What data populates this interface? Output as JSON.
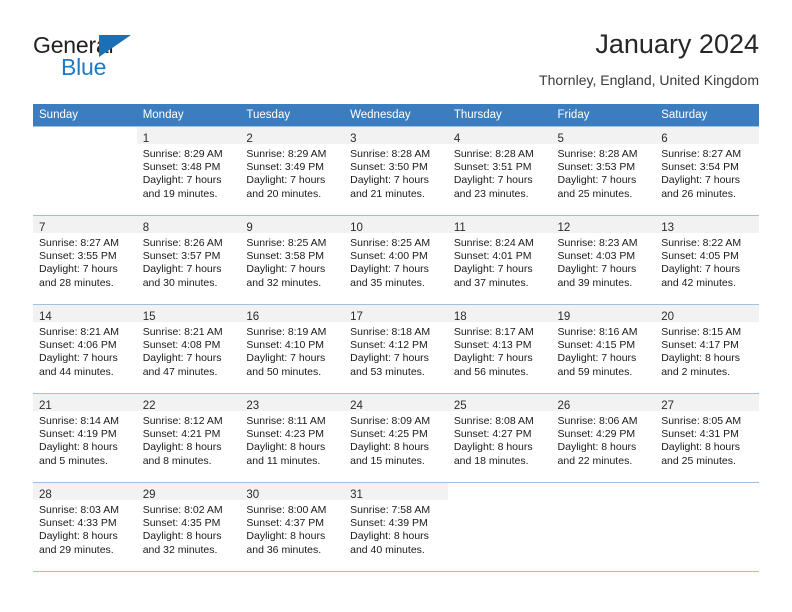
{
  "brand": {
    "name_part1": "General",
    "name_part2": "Blue",
    "logo_icon": "triangle-logo-icon"
  },
  "header": {
    "title": "January 2024",
    "subtitle": "Thornley, England, United Kingdom"
  },
  "colors": {
    "header_bar": "#3b7dbf",
    "brand_blue": "#1f7ac4",
    "daynum_bg": "#f2f2f2",
    "row_border": "#9fc0de"
  },
  "weekday_headers": [
    "Sunday",
    "Monday",
    "Tuesday",
    "Wednesday",
    "Thursday",
    "Friday",
    "Saturday"
  ],
  "weeks": [
    [
      {
        "day": "",
        "l1": "",
        "l2": "",
        "l3": "",
        "l4": ""
      },
      {
        "day": "1",
        "l1": "Sunrise: 8:29 AM",
        "l2": "Sunset: 3:48 PM",
        "l3": "Daylight: 7 hours",
        "l4": "and 19 minutes."
      },
      {
        "day": "2",
        "l1": "Sunrise: 8:29 AM",
        "l2": "Sunset: 3:49 PM",
        "l3": "Daylight: 7 hours",
        "l4": "and 20 minutes."
      },
      {
        "day": "3",
        "l1": "Sunrise: 8:28 AM",
        "l2": "Sunset: 3:50 PM",
        "l3": "Daylight: 7 hours",
        "l4": "and 21 minutes."
      },
      {
        "day": "4",
        "l1": "Sunrise: 8:28 AM",
        "l2": "Sunset: 3:51 PM",
        "l3": "Daylight: 7 hours",
        "l4": "and 23 minutes."
      },
      {
        "day": "5",
        "l1": "Sunrise: 8:28 AM",
        "l2": "Sunset: 3:53 PM",
        "l3": "Daylight: 7 hours",
        "l4": "and 25 minutes."
      },
      {
        "day": "6",
        "l1": "Sunrise: 8:27 AM",
        "l2": "Sunset: 3:54 PM",
        "l3": "Daylight: 7 hours",
        "l4": "and 26 minutes."
      }
    ],
    [
      {
        "day": "7",
        "l1": "Sunrise: 8:27 AM",
        "l2": "Sunset: 3:55 PM",
        "l3": "Daylight: 7 hours",
        "l4": "and 28 minutes."
      },
      {
        "day": "8",
        "l1": "Sunrise: 8:26 AM",
        "l2": "Sunset: 3:57 PM",
        "l3": "Daylight: 7 hours",
        "l4": "and 30 minutes."
      },
      {
        "day": "9",
        "l1": "Sunrise: 8:25 AM",
        "l2": "Sunset: 3:58 PM",
        "l3": "Daylight: 7 hours",
        "l4": "and 32 minutes."
      },
      {
        "day": "10",
        "l1": "Sunrise: 8:25 AM",
        "l2": "Sunset: 4:00 PM",
        "l3": "Daylight: 7 hours",
        "l4": "and 35 minutes."
      },
      {
        "day": "11",
        "l1": "Sunrise: 8:24 AM",
        "l2": "Sunset: 4:01 PM",
        "l3": "Daylight: 7 hours",
        "l4": "and 37 minutes."
      },
      {
        "day": "12",
        "l1": "Sunrise: 8:23 AM",
        "l2": "Sunset: 4:03 PM",
        "l3": "Daylight: 7 hours",
        "l4": "and 39 minutes."
      },
      {
        "day": "13",
        "l1": "Sunrise: 8:22 AM",
        "l2": "Sunset: 4:05 PM",
        "l3": "Daylight: 7 hours",
        "l4": "and 42 minutes."
      }
    ],
    [
      {
        "day": "14",
        "l1": "Sunrise: 8:21 AM",
        "l2": "Sunset: 4:06 PM",
        "l3": "Daylight: 7 hours",
        "l4": "and 44 minutes."
      },
      {
        "day": "15",
        "l1": "Sunrise: 8:21 AM",
        "l2": "Sunset: 4:08 PM",
        "l3": "Daylight: 7 hours",
        "l4": "and 47 minutes."
      },
      {
        "day": "16",
        "l1": "Sunrise: 8:19 AM",
        "l2": "Sunset: 4:10 PM",
        "l3": "Daylight: 7 hours",
        "l4": "and 50 minutes."
      },
      {
        "day": "17",
        "l1": "Sunrise: 8:18 AM",
        "l2": "Sunset: 4:12 PM",
        "l3": "Daylight: 7 hours",
        "l4": "and 53 minutes."
      },
      {
        "day": "18",
        "l1": "Sunrise: 8:17 AM",
        "l2": "Sunset: 4:13 PM",
        "l3": "Daylight: 7 hours",
        "l4": "and 56 minutes."
      },
      {
        "day": "19",
        "l1": "Sunrise: 8:16 AM",
        "l2": "Sunset: 4:15 PM",
        "l3": "Daylight: 7 hours",
        "l4": "and 59 minutes."
      },
      {
        "day": "20",
        "l1": "Sunrise: 8:15 AM",
        "l2": "Sunset: 4:17 PM",
        "l3": "Daylight: 8 hours",
        "l4": "and 2 minutes."
      }
    ],
    [
      {
        "day": "21",
        "l1": "Sunrise: 8:14 AM",
        "l2": "Sunset: 4:19 PM",
        "l3": "Daylight: 8 hours",
        "l4": "and 5 minutes."
      },
      {
        "day": "22",
        "l1": "Sunrise: 8:12 AM",
        "l2": "Sunset: 4:21 PM",
        "l3": "Daylight: 8 hours",
        "l4": "and 8 minutes."
      },
      {
        "day": "23",
        "l1": "Sunrise: 8:11 AM",
        "l2": "Sunset: 4:23 PM",
        "l3": "Daylight: 8 hours",
        "l4": "and 11 minutes."
      },
      {
        "day": "24",
        "l1": "Sunrise: 8:09 AM",
        "l2": "Sunset: 4:25 PM",
        "l3": "Daylight: 8 hours",
        "l4": "and 15 minutes."
      },
      {
        "day": "25",
        "l1": "Sunrise: 8:08 AM",
        "l2": "Sunset: 4:27 PM",
        "l3": "Daylight: 8 hours",
        "l4": "and 18 minutes."
      },
      {
        "day": "26",
        "l1": "Sunrise: 8:06 AM",
        "l2": "Sunset: 4:29 PM",
        "l3": "Daylight: 8 hours",
        "l4": "and 22 minutes."
      },
      {
        "day": "27",
        "l1": "Sunrise: 8:05 AM",
        "l2": "Sunset: 4:31 PM",
        "l3": "Daylight: 8 hours",
        "l4": "and 25 minutes."
      }
    ],
    [
      {
        "day": "28",
        "l1": "Sunrise: 8:03 AM",
        "l2": "Sunset: 4:33 PM",
        "l3": "Daylight: 8 hours",
        "l4": "and 29 minutes."
      },
      {
        "day": "29",
        "l1": "Sunrise: 8:02 AM",
        "l2": "Sunset: 4:35 PM",
        "l3": "Daylight: 8 hours",
        "l4": "and 32 minutes."
      },
      {
        "day": "30",
        "l1": "Sunrise: 8:00 AM",
        "l2": "Sunset: 4:37 PM",
        "l3": "Daylight: 8 hours",
        "l4": "and 36 minutes."
      },
      {
        "day": "31",
        "l1": "Sunrise: 7:58 AM",
        "l2": "Sunset: 4:39 PM",
        "l3": "Daylight: 8 hours",
        "l4": "and 40 minutes."
      },
      {
        "day": "",
        "l1": "",
        "l2": "",
        "l3": "",
        "l4": ""
      },
      {
        "day": "",
        "l1": "",
        "l2": "",
        "l3": "",
        "l4": ""
      },
      {
        "day": "",
        "l1": "",
        "l2": "",
        "l3": "",
        "l4": ""
      }
    ]
  ]
}
